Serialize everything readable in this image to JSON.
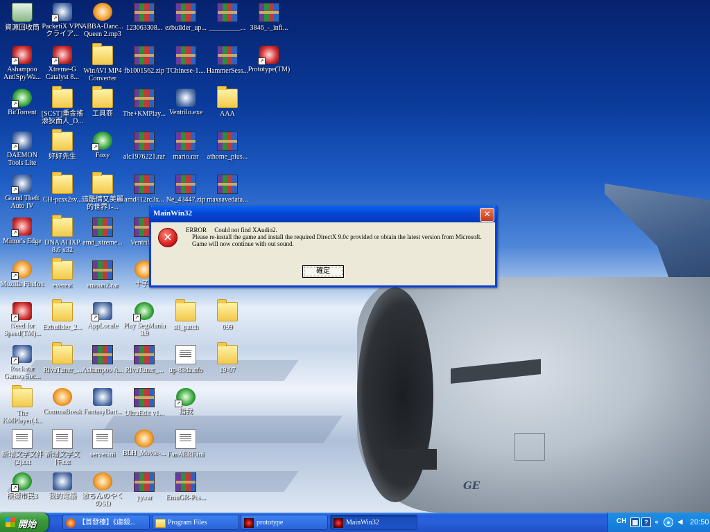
{
  "desktop": {
    "icons": [
      {
        "label": "資源回收筒",
        "kind": "bin",
        "shortcut": false
      },
      {
        "label": "PacketiX VPN クライア...",
        "kind": "app",
        "shortcut": true
      },
      {
        "label": "ABBA-Danc... Queen 2.mp3",
        "kind": "app-orange",
        "shortcut": false
      },
      {
        "label": "123063308...",
        "kind": "rar",
        "shortcut": false
      },
      {
        "label": "ezbuilder_up...",
        "kind": "rar",
        "shortcut": false
      },
      {
        "label": "_________...",
        "kind": "rar",
        "shortcut": false
      },
      {
        "label": "3846_-_infi...",
        "kind": "rar",
        "shortcut": false
      },
      {
        "label": "Ashampoo AntiSpyWa...",
        "kind": "app-red",
        "shortcut": true
      },
      {
        "label": "Xtreme-G Catalyst 8...",
        "kind": "app-red",
        "shortcut": true
      },
      {
        "label": "WinAVI MP4 Converter",
        "kind": "folder",
        "shortcut": false
      },
      {
        "label": "fb1001562.zip",
        "kind": "rar",
        "shortcut": false
      },
      {
        "label": "TChinese-1....",
        "kind": "rar",
        "shortcut": false
      },
      {
        "label": "HammerSess...",
        "kind": "rar",
        "shortcut": false
      },
      {
        "label": "Prototype(TM)",
        "kind": "app-red",
        "shortcut": true
      },
      {
        "label": "BitTorrent",
        "kind": "app-green",
        "shortcut": true
      },
      {
        "label": "[SCST]重金搖滾狄面人_D...",
        "kind": "folder",
        "shortcut": false
      },
      {
        "label": "工具商",
        "kind": "folder",
        "shortcut": false
      },
      {
        "label": "The+KMPlay...",
        "kind": "rar",
        "shortcut": false
      },
      {
        "label": "Ventrilo.exe",
        "kind": "app",
        "shortcut": false
      },
      {
        "label": "AAA",
        "kind": "folder",
        "shortcut": false
      },
      {
        "label": "DAEMON Tools Lite",
        "kind": "app",
        "shortcut": true
      },
      {
        "label": "好好先生",
        "kind": "folder",
        "shortcut": false
      },
      {
        "label": "Foxy",
        "kind": "app-green",
        "shortcut": true
      },
      {
        "label": "alc1976221.rar",
        "kind": "rar",
        "shortcut": false
      },
      {
        "label": "mario.rar",
        "kind": "rar",
        "shortcut": false
      },
      {
        "label": "athome_plus...",
        "kind": "rar",
        "shortcut": false
      },
      {
        "label": "Grand Theft Auto IV",
        "kind": "app",
        "shortcut": true
      },
      {
        "label": "CH-pcsx2sv...",
        "kind": "folder",
        "shortcut": false
      },
      {
        "label": "這酷情又美麗的世界1-...",
        "kind": "folder",
        "shortcut": false
      },
      {
        "label": "amd812rc3x...",
        "kind": "rar",
        "shortcut": false
      },
      {
        "label": "Ne_43447.zip",
        "kind": "rar",
        "shortcut": false
      },
      {
        "label": "maxsavedata...",
        "kind": "rar",
        "shortcut": false
      },
      {
        "label": "Mirror's Edge",
        "kind": "app-red",
        "shortcut": true
      },
      {
        "label": "DNA ATIXP 8.6 x32",
        "kind": "folder",
        "shortcut": false
      },
      {
        "label": "amd_xtreme...",
        "kind": "rar",
        "shortcut": false
      },
      {
        "label": "Ventrilo...",
        "kind": "rar",
        "shortcut": false
      },
      {
        "label": "Mozilla Firefox",
        "kind": "app-orange",
        "shortcut": true
      },
      {
        "label": "everest",
        "kind": "folder",
        "shortcut": false
      },
      {
        "label": "amoon2.rar",
        "kind": "rar",
        "shortcut": false
      },
      {
        "label": "十子...",
        "kind": "app-orange",
        "shortcut": false
      },
      {
        "label": "Need for Speed(TM)...",
        "kind": "app-red",
        "shortcut": true
      },
      {
        "label": "Ezbuilder_2...",
        "kind": "folder",
        "shortcut": false
      },
      {
        "label": "AppLocale",
        "kind": "app",
        "shortcut": true
      },
      {
        "label": "Play SegMania 3.9",
        "kind": "app-green",
        "shortcut": true
      },
      {
        "label": "sli_patch",
        "kind": "folder",
        "shortcut": false
      },
      {
        "label": "099",
        "kind": "folder",
        "shortcut": false
      },
      {
        "label": "Rockstar Games Soc...",
        "kind": "app",
        "shortcut": true
      },
      {
        "label": "RivaTuner_...",
        "kind": "folder",
        "shortcut": false
      },
      {
        "label": "Ashampoo A...",
        "kind": "rar",
        "shortcut": false
      },
      {
        "label": "RivaTuner_...",
        "kind": "rar",
        "shortcut": false
      },
      {
        "label": "up-83da.nfo",
        "kind": "doc",
        "shortcut": false
      },
      {
        "label": "19-07",
        "kind": "folder",
        "shortcut": false
      },
      {
        "label": "The KMPlayer(4...",
        "kind": "folder",
        "shortcut": false
      },
      {
        "label": "CommaBreak",
        "kind": "app-orange",
        "shortcut": false
      },
      {
        "label": "FantasyBart...",
        "kind": "app",
        "shortcut": false
      },
      {
        "label": "UltraEdit v1...",
        "kind": "rar",
        "shortcut": false
      },
      {
        "label": "指我",
        "kind": "app-green",
        "shortcut": true
      },
      {
        "label": "新增文字文件 (2).txt",
        "kind": "doc",
        "shortcut": false
      },
      {
        "label": "新增文字文件.txt",
        "kind": "doc",
        "shortcut": false
      },
      {
        "label": "server.ini",
        "kind": "doc",
        "shortcut": false
      },
      {
        "label": "BLH_Movie-...",
        "kind": "app-orange",
        "shortcut": false
      },
      {
        "label": "FanAERF.ini",
        "kind": "doc",
        "shortcut": false
      },
      {
        "label": "模擬市民3",
        "kind": "app-green",
        "shortcut": true
      },
      {
        "label": "我的電腦",
        "kind": "app",
        "shortcut": false
      },
      {
        "label": "激ちんのやくのSD",
        "kind": "app-orange",
        "shortcut": false
      },
      {
        "label": "yy.rar",
        "kind": "rar",
        "shortcut": false
      },
      {
        "label": "EmuGR-Pcs...",
        "kind": "rar",
        "shortcut": false
      }
    ]
  },
  "dialog": {
    "title": "MainWin32",
    "message_lines": "ERROR     Could not find XAudio2.\n    Please re-install the game and install the required DirectX 9.0c provided or obtain the latest version from Microsoft.\n    Game will now continue with out sound.",
    "ok_label": "確定",
    "close_glyph": "✕",
    "error_glyph": "✕"
  },
  "wallpaper": {
    "engine_brand": "GE"
  },
  "taskbar": {
    "start_label": "開始",
    "tasks": [
      {
        "label": "【首發檯】《虐殺...",
        "icon": "firefox-icon",
        "active": false
      },
      {
        "label": "Program Files",
        "icon": "folder-icon",
        "active": false
      },
      {
        "label": "prototype",
        "icon": "prototype-icon",
        "active": false
      },
      {
        "label": "MainWin32",
        "icon": "prototype-icon",
        "active": true
      }
    ],
    "tray": {
      "lang": "CH",
      "clock": "20:50"
    }
  }
}
